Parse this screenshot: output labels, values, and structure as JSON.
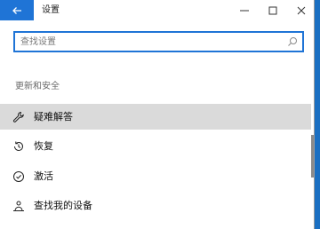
{
  "window": {
    "title": "设置",
    "back_icon": "arrow-left-icon",
    "controls": [
      "minimize-icon",
      "maximize-icon",
      "close-icon"
    ]
  },
  "search": {
    "value": "",
    "placeholder": "查找设置",
    "icon": "search-icon"
  },
  "section": {
    "title": "更新和安全"
  },
  "nav": {
    "items": [
      {
        "label": "疑难解答",
        "icon": "wrench-icon",
        "selected": true
      },
      {
        "label": "恢复",
        "icon": "history-icon",
        "selected": false
      },
      {
        "label": "激活",
        "icon": "check-circle-icon",
        "selected": false
      },
      {
        "label": "查找我的设备",
        "icon": "person-location-icon",
        "selected": false
      }
    ]
  },
  "colors": {
    "accent": "#1f74d6",
    "selected_bg": "#dadada",
    "desktop": "#1a6fc2"
  }
}
